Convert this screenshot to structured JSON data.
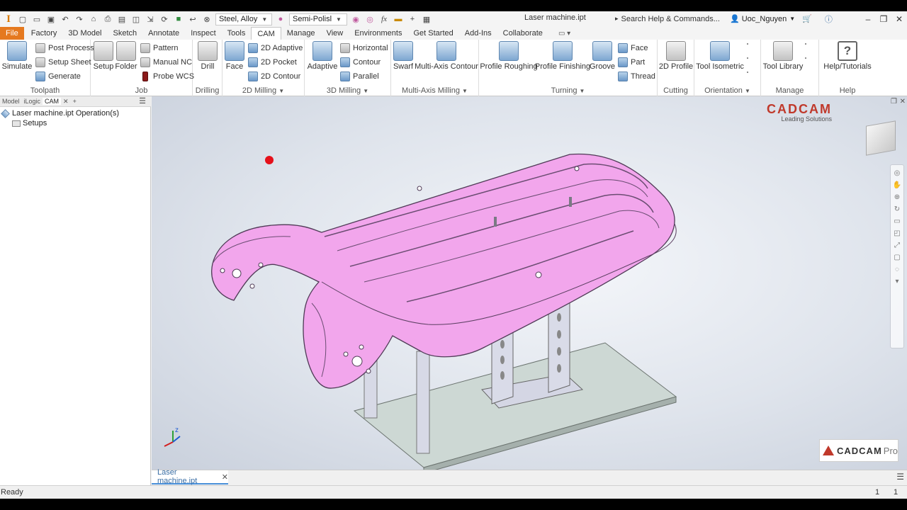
{
  "qat": {
    "material": "Steel, Alloy",
    "appearance": "Semi-Polisl",
    "fx": "fx",
    "title": "Laser machine.ipt",
    "search": "Search Help & Commands...",
    "user": "Uoc_Nguyen"
  },
  "tabs": [
    "File",
    "Factory",
    "3D Model",
    "Sketch",
    "Annotate",
    "Inspect",
    "Tools",
    "CAM",
    "Manage",
    "View",
    "Environments",
    "Get Started",
    "Add-Ins",
    "Collaborate"
  ],
  "ribbon": {
    "toolpath": {
      "label": "Toolpath",
      "simulate": "Simulate",
      "post_process": "Post Process",
      "setup_sheet": "Setup Sheet",
      "generate": "Generate"
    },
    "job": {
      "label": "Job",
      "setup": "Setup",
      "folder": "Folder",
      "pattern": "Pattern",
      "manual_nc": "Manual NC",
      "probe_wcs": "Probe WCS"
    },
    "drilling": {
      "label": "Drilling",
      "drill": "Drill"
    },
    "milling2d": {
      "label": "2D Milling",
      "face": "Face",
      "adaptive": "2D Adaptive",
      "pocket": "2D Pocket",
      "contour": "2D Contour"
    },
    "milling3d": {
      "label": "3D Milling",
      "adaptive": "Adaptive",
      "horizontal": "Horizontal",
      "contour": "Contour",
      "parallel": "Parallel"
    },
    "multiaxis": {
      "label": "Multi-Axis Milling",
      "swarf": "Swarf",
      "contour": "Multi-Axis Contour"
    },
    "turning": {
      "label": "Turning",
      "roughing": "Profile Roughing",
      "finishing": "Profile Finishing",
      "groove": "Groove",
      "face": "Face",
      "part": "Part",
      "thread": "Thread"
    },
    "cutting": {
      "label": "Cutting",
      "profile": "2D Profile"
    },
    "orientation": {
      "label": "Orientation",
      "iso": "Tool Isometric"
    },
    "manage": {
      "label": "Manage",
      "library": "Tool Library"
    },
    "help": {
      "label": "Help",
      "tutorials": "Help/Tutorials"
    }
  },
  "browser": {
    "tabs": [
      "Model",
      "iLogic",
      "CAM"
    ],
    "root": "Laser machine.ipt Operation(s)",
    "child": "Setups"
  },
  "viewport": {
    "logo_main": "CAD",
    "logo_accent": "CAM",
    "logo_sub": "Leading Solutions",
    "pro_logo": "CADCAM",
    "pro_suffix": "Pro",
    "axis_z": "z"
  },
  "document_tab": "Laser machine.ipt",
  "status": {
    "text": "Ready",
    "num1": "1",
    "num2": "1"
  }
}
